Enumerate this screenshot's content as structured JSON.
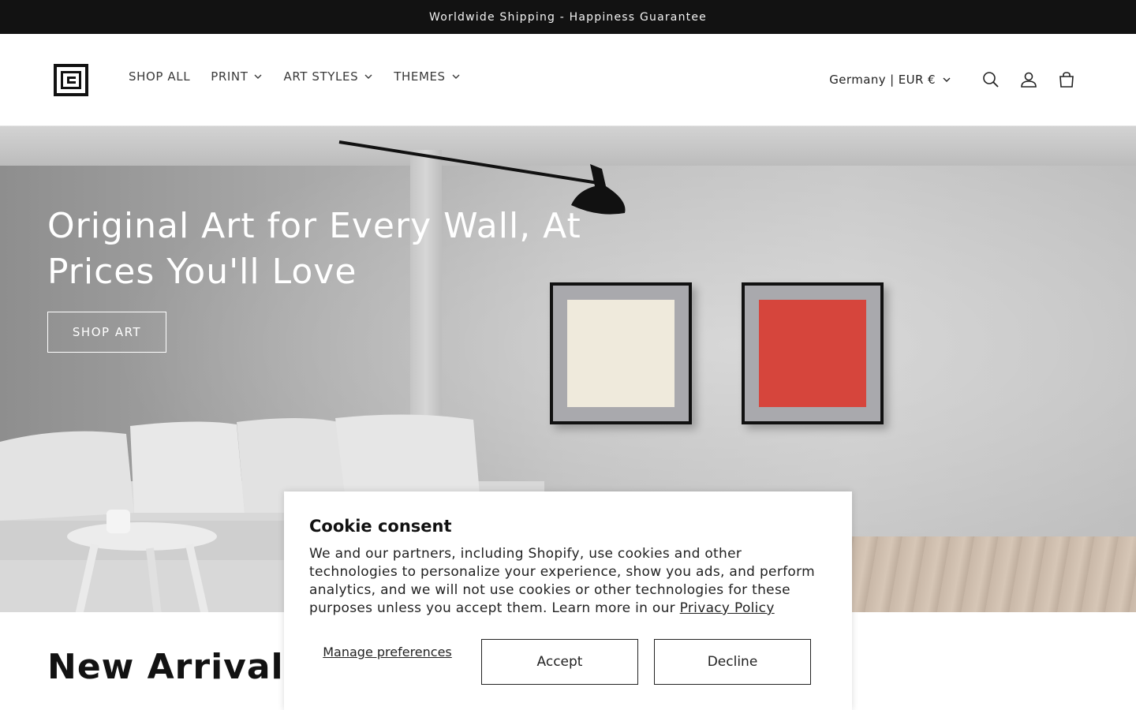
{
  "announcement": {
    "text": "Worldwide Shipping - Happiness Guarantee"
  },
  "header": {
    "logo_icon": "store-logo-icon",
    "nav": [
      {
        "label": "SHOP ALL",
        "has_dropdown": false
      },
      {
        "label": "PRINT",
        "has_dropdown": true
      },
      {
        "label": "ART STYLES",
        "has_dropdown": true
      },
      {
        "label": "THEMES",
        "has_dropdown": true
      }
    ],
    "locale": "Germany | EUR €",
    "icons": [
      "search-icon",
      "account-icon",
      "cart-icon"
    ]
  },
  "hero": {
    "title": "Original Art for Every Wall, At Prices You'll Love",
    "button_label": "SHOP ART"
  },
  "section": {
    "title": "New Arrivals"
  },
  "cookie": {
    "title": "Cookie consent",
    "text": "We and our partners, including Shopify, use cookies and other technologies to personalize your experience, show you ads, and perform analytics, and we will not use cookies or other technologies for these purposes unless you accept them. Learn more in our ",
    "link": "Privacy Policy",
    "manage_label": "Manage preferences",
    "accept_label": "Accept",
    "decline_label": "Decline"
  }
}
